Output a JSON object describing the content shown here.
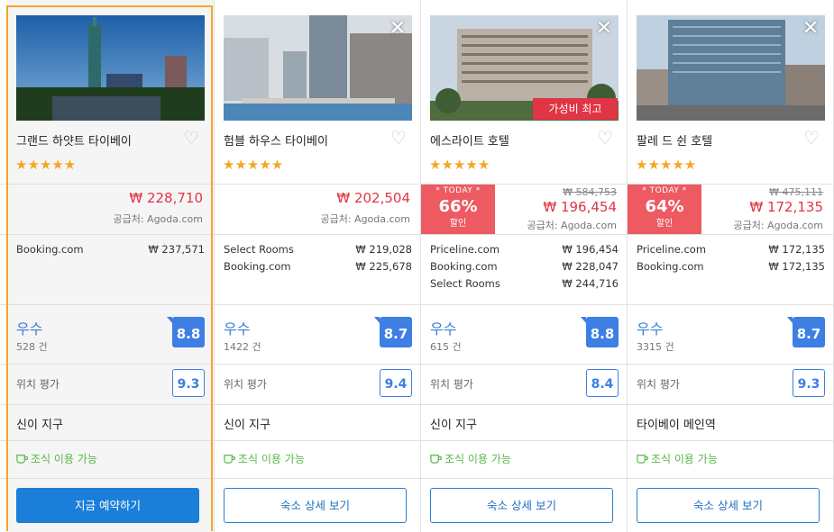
{
  "hotels": [
    {
      "name": "그랜드 하얏트 타이베이",
      "price": "₩ 228,710",
      "supplier": "공급처: Agoda.com",
      "offers": [
        {
          "site": "Booking.com",
          "price": "₩  237,571"
        }
      ],
      "rating_label": "우수",
      "review_count": "528 건",
      "score": "8.8",
      "location_label": "위치 평가",
      "location_score": "9.3",
      "district": "신이 지구",
      "breakfast": "조식 이용 가능",
      "button": "지금 예약하기",
      "stars": "★★★★★"
    },
    {
      "name": "험블 하우스 타이베이",
      "price": "₩ 202,504",
      "supplier": "공급처: Agoda.com",
      "offers": [
        {
          "site": "Select Rooms",
          "price": "₩  219,028"
        },
        {
          "site": "Booking.com",
          "price": "₩  225,678"
        }
      ],
      "rating_label": "우수",
      "review_count": "1422 건",
      "score": "8.7",
      "location_label": "위치 평가",
      "location_score": "9.4",
      "district": "신이 지구",
      "breakfast": "조식 이용 가능",
      "button": "숙소 상세 보기",
      "stars": "★★★★★"
    },
    {
      "name": "에스라이트 호텔",
      "value_tag": "가성비 최고",
      "today_label": "* TODAY *",
      "discount": "66%",
      "discount_word": "할인",
      "original_price": "₩ 584,753",
      "price": "₩ 196,454",
      "supplier": "공급처: Agoda.com",
      "offers": [
        {
          "site": "Priceline.com",
          "price": "₩  196,454"
        },
        {
          "site": "Booking.com",
          "price": "₩  228,047"
        },
        {
          "site": "Select Rooms",
          "price": "₩  244,716"
        }
      ],
      "rating_label": "우수",
      "review_count": "615 건",
      "score": "8.8",
      "location_label": "위치 평가",
      "location_score": "8.4",
      "district": "신이 지구",
      "breakfast": "조식 이용 가능",
      "button": "숙소 상세 보기",
      "stars": "★★★★★"
    },
    {
      "name": "팔레 드 쉰 호텔",
      "today_label": "* TODAY *",
      "discount": "64%",
      "discount_word": "할인",
      "original_price": "₩ 475,111",
      "price": "₩ 172,135",
      "supplier": "공급처: Agoda.com",
      "offers": [
        {
          "site": "Priceline.com",
          "price": "₩  172,135"
        },
        {
          "site": "Booking.com",
          "price": "₩  172,135"
        }
      ],
      "rating_label": "우수",
      "review_count": "3315 건",
      "score": "8.7",
      "location_label": "위치 평가",
      "location_score": "9.3",
      "district": "타이베이 메인역",
      "breakfast": "조식 이용 가능",
      "button": "숙소 상세 보기",
      "stars": "★★★★★"
    }
  ],
  "icons": {
    "close": "close-icon",
    "favorite": "heart-icon",
    "breakfast": "coffee-cup-icon"
  },
  "colors": {
    "accent": "#1b7ed9",
    "price_red": "#e03545",
    "star": "#f5a623",
    "score_blue": "#3d7fe2",
    "breakfast_green": "#5ab54a",
    "selected_border": "#f5a623"
  }
}
